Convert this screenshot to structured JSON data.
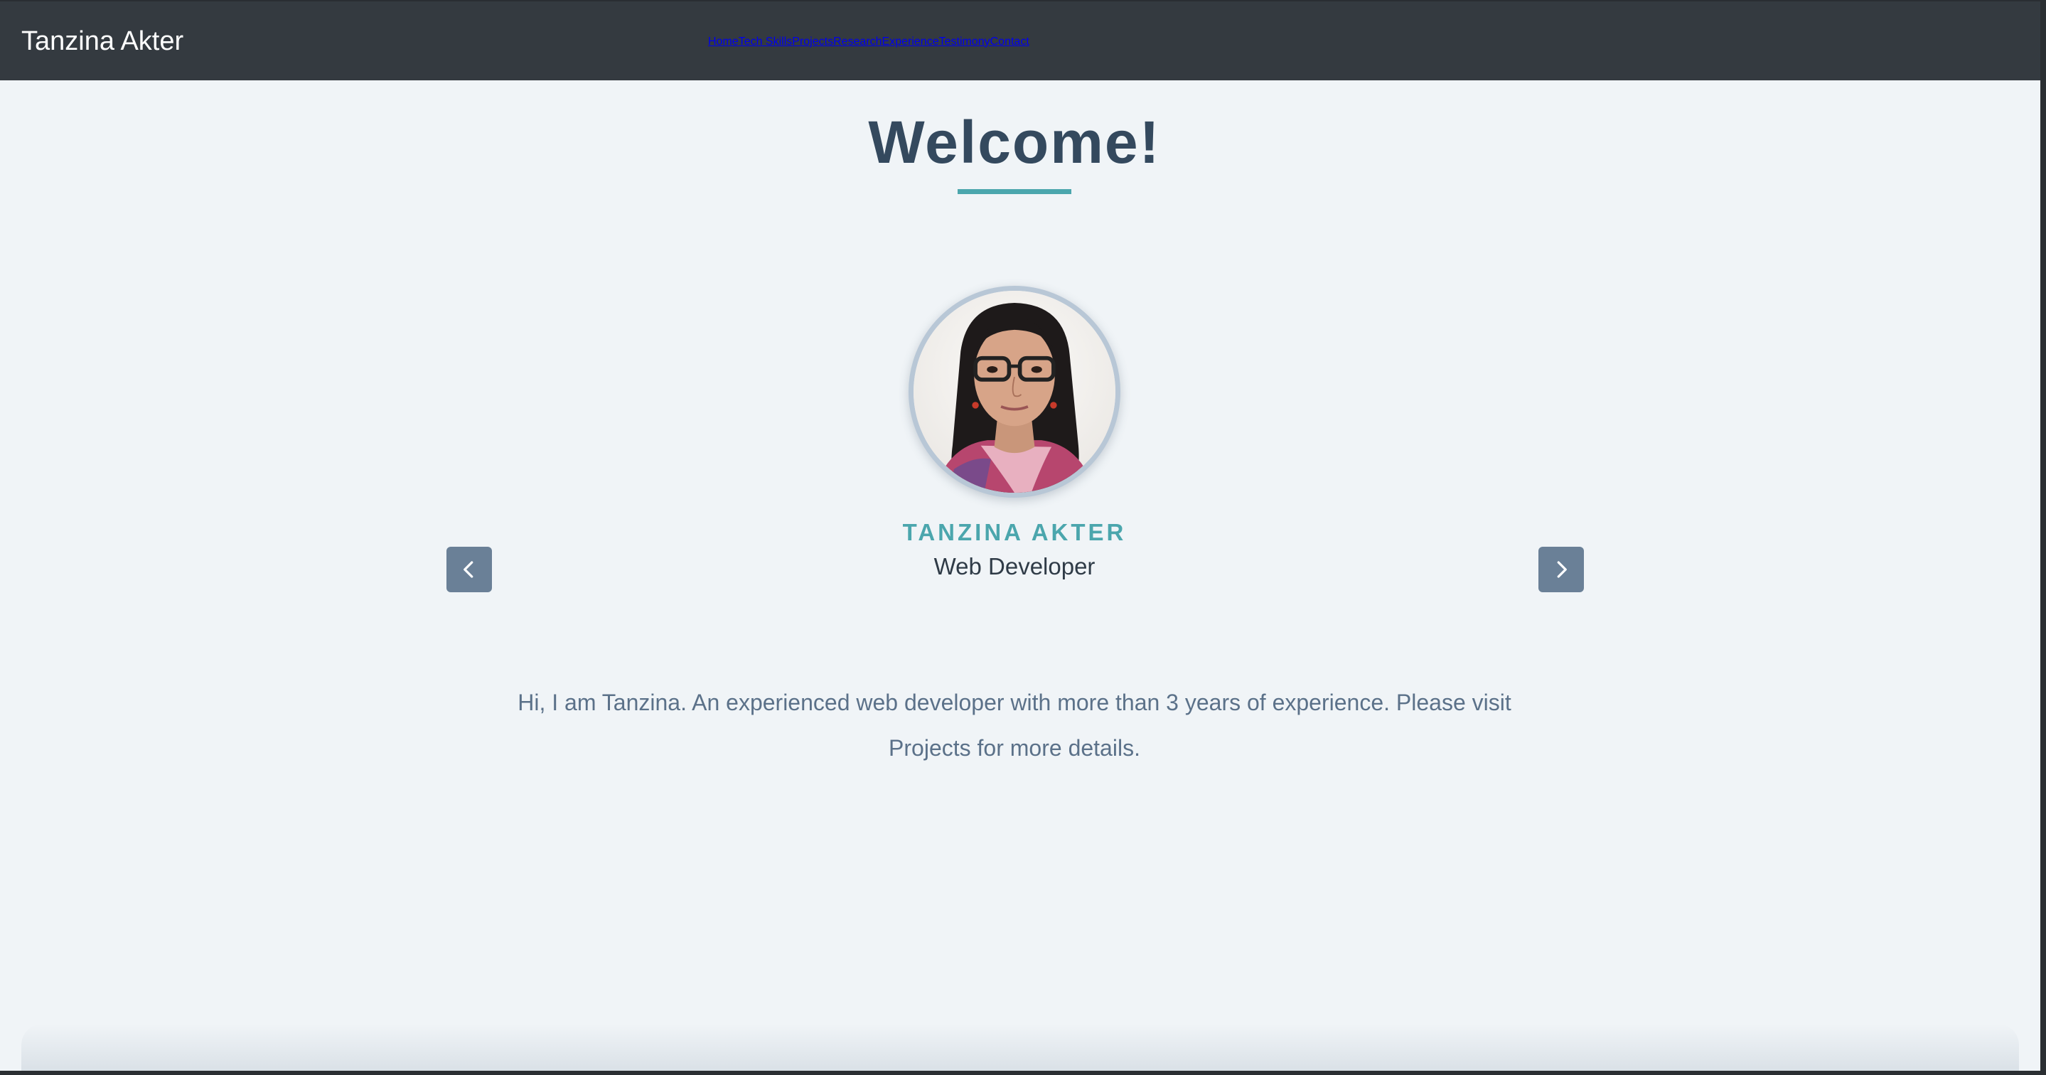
{
  "navbar": {
    "brand": "Tanzina Akter",
    "links": [
      "Home",
      "Tech Skills",
      "Projects",
      "Research",
      "Experience",
      "Testimony",
      "Contact"
    ]
  },
  "hero": {
    "heading": "Welcome!",
    "name": "TANZINA AKTER",
    "role": "Web Developer",
    "bio": "Hi, I am Tanzina. An experienced web developer with more than 3 years of experience. Please visit Projects for more details."
  },
  "carousel": {
    "prev_icon": "chevron-left-icon",
    "next_icon": "chevron-right-icon"
  },
  "colors": {
    "navbar_bg": "#343a40",
    "page_bg": "#f0f4f7",
    "accent": "#4ba6ad",
    "heading": "#34495e",
    "button_bg": "#6a8097"
  }
}
